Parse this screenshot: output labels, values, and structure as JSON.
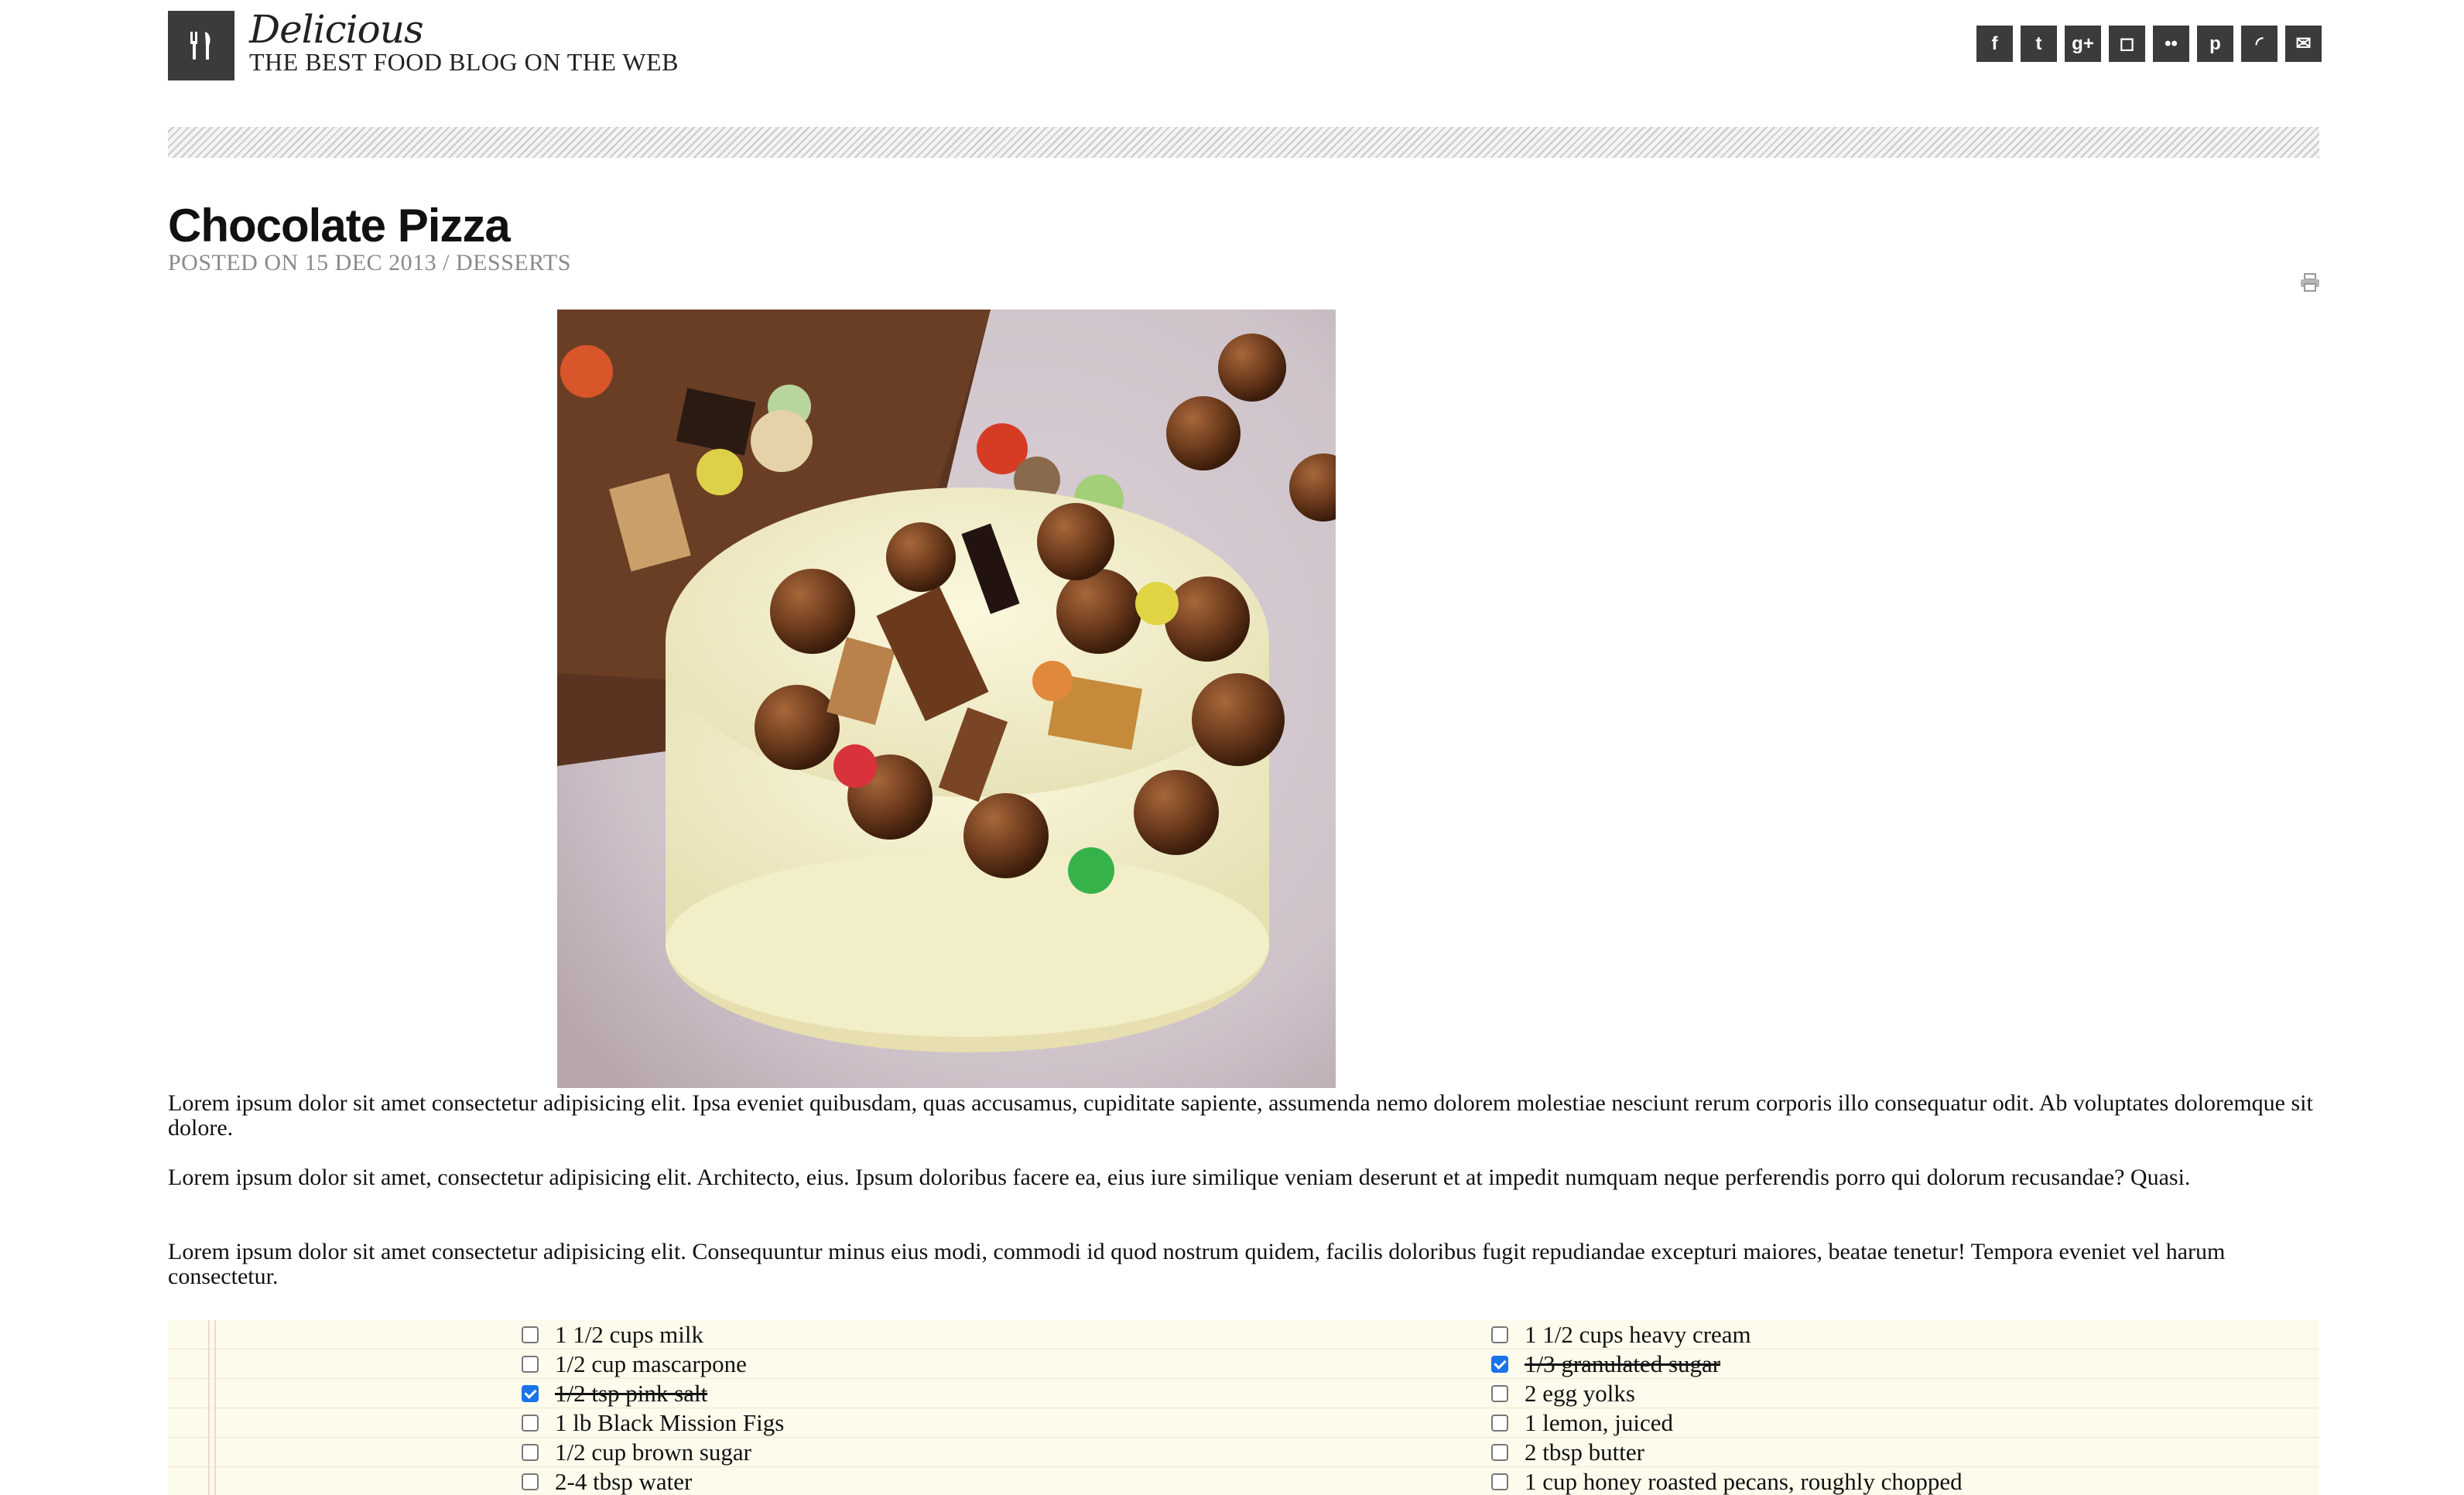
{
  "site": {
    "title": "Delicious",
    "tagline": "THE BEST FOOD BLOG ON THE WEB",
    "logo_icon": "fork-knife-icon"
  },
  "social": [
    {
      "name": "facebook-icon",
      "glyph": "f"
    },
    {
      "name": "twitter-icon",
      "glyph": "t"
    },
    {
      "name": "google-plus-icon",
      "glyph": "g+"
    },
    {
      "name": "instagram-icon",
      "glyph": "◻"
    },
    {
      "name": "flickr-icon",
      "glyph": "••"
    },
    {
      "name": "pinterest-icon",
      "glyph": "p"
    },
    {
      "name": "rss-icon",
      "glyph": "◜"
    },
    {
      "name": "email-icon",
      "glyph": "✉"
    }
  ],
  "post": {
    "title": "Chocolate Pizza",
    "meta": "POSTED ON 15 DEC 2013 / DESSERTS",
    "image_alt": "Chocolate pizza topped with candies",
    "paragraphs": [
      "Lorem ipsum dolor sit amet consectetur adipisicing elit. Ipsa eveniet quibusdam, quas accusamus, cupiditate sapiente, assumenda nemo dolorem molestiae nesciunt rerum corporis illo consequatur odit. Ab voluptates doloremque sit dolore.",
      "Lorem ipsum dolor sit amet, consectetur adipisicing elit. Architecto, eius. Ipsum doloribus facere ea, eius iure similique veniam deserunt et at impedit numquam neque perferendis porro qui dolorum recusandae? Quasi.",
      "Lorem ipsum dolor sit amet consectetur adipisicing elit. Consequuntur minus eius modi, commodi id quod nostrum quidem, facilis doloribus fugit repudiandae excepturi maiores, beatae tenetur! Tempora eveniet vel harum consectetur."
    ]
  },
  "ingredients": {
    "left": [
      {
        "text": "1 1/2 cups milk",
        "checked": false
      },
      {
        "text": "1/2 cup mascarpone",
        "checked": false
      },
      {
        "text": "1/2 tsp pink salt",
        "checked": true
      },
      {
        "text": "1 lb Black Mission Figs",
        "checked": false
      },
      {
        "text": "1/2 cup brown sugar",
        "checked": false
      },
      {
        "text": "2-4 tbsp water",
        "checked": false
      }
    ],
    "right": [
      {
        "text": "1 1/2 cups heavy cream",
        "checked": false
      },
      {
        "text": "1/3 granulated sugar",
        "checked": true
      },
      {
        "text": "2 egg yolks",
        "checked": false
      },
      {
        "text": "1 lemon, juiced",
        "checked": false
      },
      {
        "text": "2 tbsp butter",
        "checked": false
      },
      {
        "text": "1 cup honey roasted pecans, roughly chopped",
        "checked": false
      }
    ]
  },
  "colors": {
    "accent_dark": "#3b3b3b",
    "meta_gray": "#8a8a8a",
    "checkbox_blue": "#1a73e8",
    "notepad_bg": "#fdfbec"
  }
}
